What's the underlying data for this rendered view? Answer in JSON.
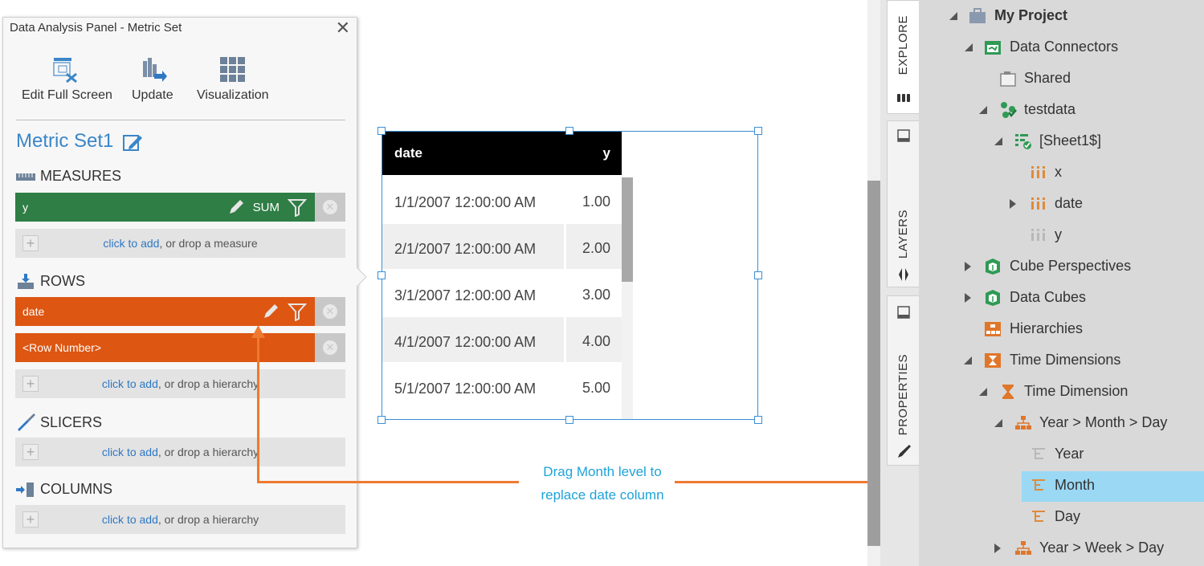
{
  "panel": {
    "title": "Data Analysis Panel - Metric Set",
    "toolbar": {
      "edit_full_screen": "Edit Full Screen",
      "update": "Update",
      "visualization": "Visualization"
    },
    "metric_set_name": "Metric Set1",
    "measures": {
      "label": "MEASURES",
      "items": [
        {
          "name": "y",
          "aggregation": "SUM"
        }
      ],
      "add_link": "click to add",
      "add_suffix": ", or drop a measure"
    },
    "rows": {
      "label": "ROWS",
      "items": [
        {
          "name": "date"
        },
        {
          "name": "<Row Number>"
        }
      ],
      "add_link": "click to add",
      "add_suffix": ", or drop a hierarchy"
    },
    "slicers": {
      "label": "SLICERS",
      "add_link": "click to add",
      "add_suffix": ", or drop a hierarchy"
    },
    "columns": {
      "label": "COLUMNS",
      "add_link": "click to add",
      "add_suffix": ", or drop a hierarchy"
    }
  },
  "table": {
    "columns": [
      "date",
      "y"
    ],
    "rows": [
      [
        "1/1/2007 12:00:00 AM",
        "1.00"
      ],
      [
        "2/1/2007 12:00:00 AM",
        "2.00"
      ],
      [
        "3/1/2007 12:00:00 AM",
        "3.00"
      ],
      [
        "4/1/2007 12:00:00 AM",
        "4.00"
      ],
      [
        "5/1/2007 12:00:00 AM",
        "5.00"
      ]
    ]
  },
  "annotation": {
    "line1": "Drag Month level to",
    "line2": "replace date column",
    "color": "#1ea3d8",
    "connector_color": "#ee7a30"
  },
  "side_tabs": {
    "explore": "EXPLORE",
    "layers": "LAYERS",
    "properties": "PROPERTIES"
  },
  "tree": {
    "project": "My Project",
    "data_connectors": "Data Connectors",
    "shared": "Shared",
    "testdata": "testdata",
    "sheet": "[Sheet1$]",
    "col_x": "x",
    "col_date": "date",
    "col_y": "y",
    "cube_perspectives": "Cube Perspectives",
    "data_cubes": "Data Cubes",
    "hierarchies": "Hierarchies",
    "time_dimensions": "Time Dimensions",
    "time_dimension": "Time Dimension",
    "ymd": "Year > Month > Day",
    "year": "Year",
    "month": "Month",
    "day": "Day",
    "ywd": "Year > Week > Day"
  },
  "colors": {
    "measure_bar": "#2f7e45",
    "row_bar": "#dd5612",
    "link": "#2f78c4",
    "selection": "#9ad8f4",
    "title_blue": "#3a86c8"
  }
}
